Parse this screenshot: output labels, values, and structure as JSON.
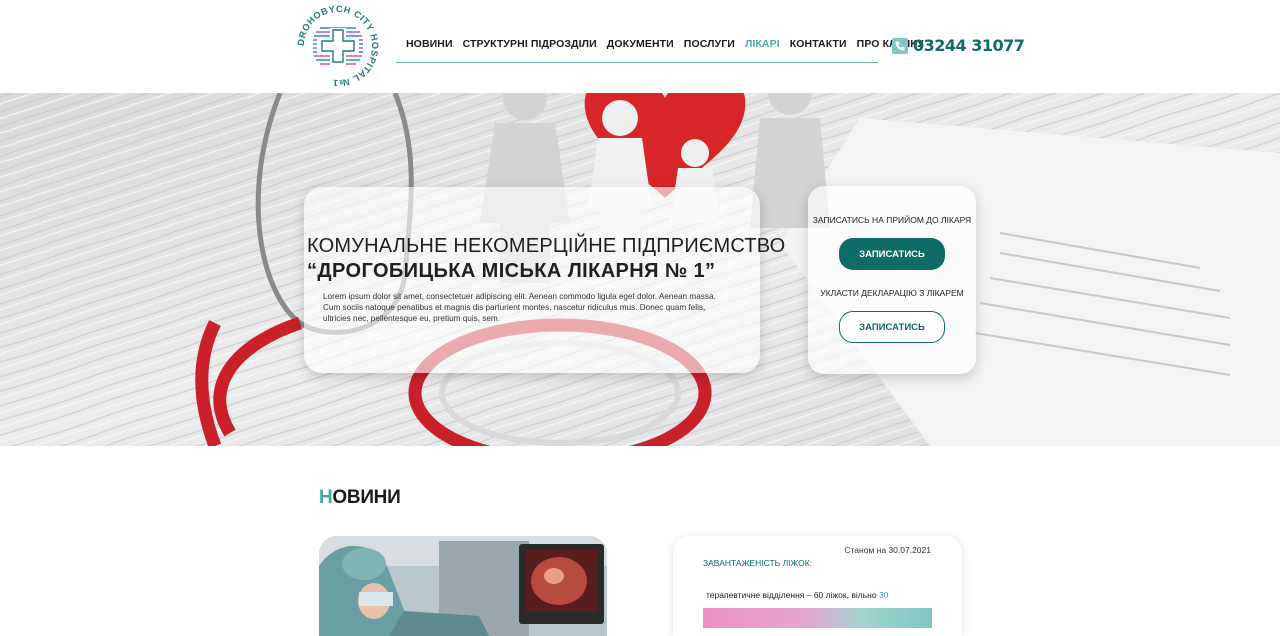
{
  "header": {
    "logo_alt": "Drohobych City Hospital №1",
    "logo_text": "DROHOBYCH CITY HOSPITAL №1",
    "nav": [
      {
        "label": "НОВИНИ",
        "active": false
      },
      {
        "label": "СТРУКТУРНІ ПІДРОЗДІЛИ",
        "active": false
      },
      {
        "label": "ДОКУМЕНТИ",
        "active": false
      },
      {
        "label": "ПОСЛУГИ",
        "active": false
      },
      {
        "label": "ЛІКАРІ",
        "active": true
      },
      {
        "label": "КОНТАКТИ",
        "active": false
      },
      {
        "label": "ПРО КЛІНІКУ",
        "active": false
      }
    ],
    "phone": "03244 31077",
    "phone_icon": "phone-icon"
  },
  "hero": {
    "line1": "КОМУНАЛЬНЕ НЕКОМЕРЦІЙНЕ ПІДПРИЄМСТВО",
    "line2": "“ДРОГОБИЦЬКА МІСЬКА ЛІКАРНЯ № 1”",
    "lorem": "Lorem ipsum dolor sit amet, consectetuer adipiscing elit. Aenean commodo ligula eget dolor. Aenean massa. Cum sociis natoque penatibus et magnis dis parturient montes, nascetur ridiculus mus. Donec quam felis, ultricies nec, pellentesque eu, pretium quis, sem.",
    "appointment_label": "ЗАПИСАТИСЬ НА ПРИЙОМ ДО ЛІКАРЯ",
    "appointment_button": "ЗАПИСАТИСЬ",
    "declaration_label": "УКЛАСТИ ДЕКЛАРАЦІЮ З ЛІКАРЕМ",
    "declaration_button": "ЗАПИСАТИСЬ"
  },
  "news": {
    "title_first": "Н",
    "title_rest": "ОВИНИ"
  },
  "beds": {
    "date": "Станом на 30.07.2021",
    "title": "ЗАВАНТАЖЕНІСТЬ ЛІЖОК:",
    "row_text": "терапевтичне відділення – 60 ліжок, вільно ",
    "free": "30"
  },
  "colors": {
    "brand_dark": "#0f6b67",
    "brand_light": "#3fa9a5",
    "accent_pink": "#e24ca8"
  }
}
